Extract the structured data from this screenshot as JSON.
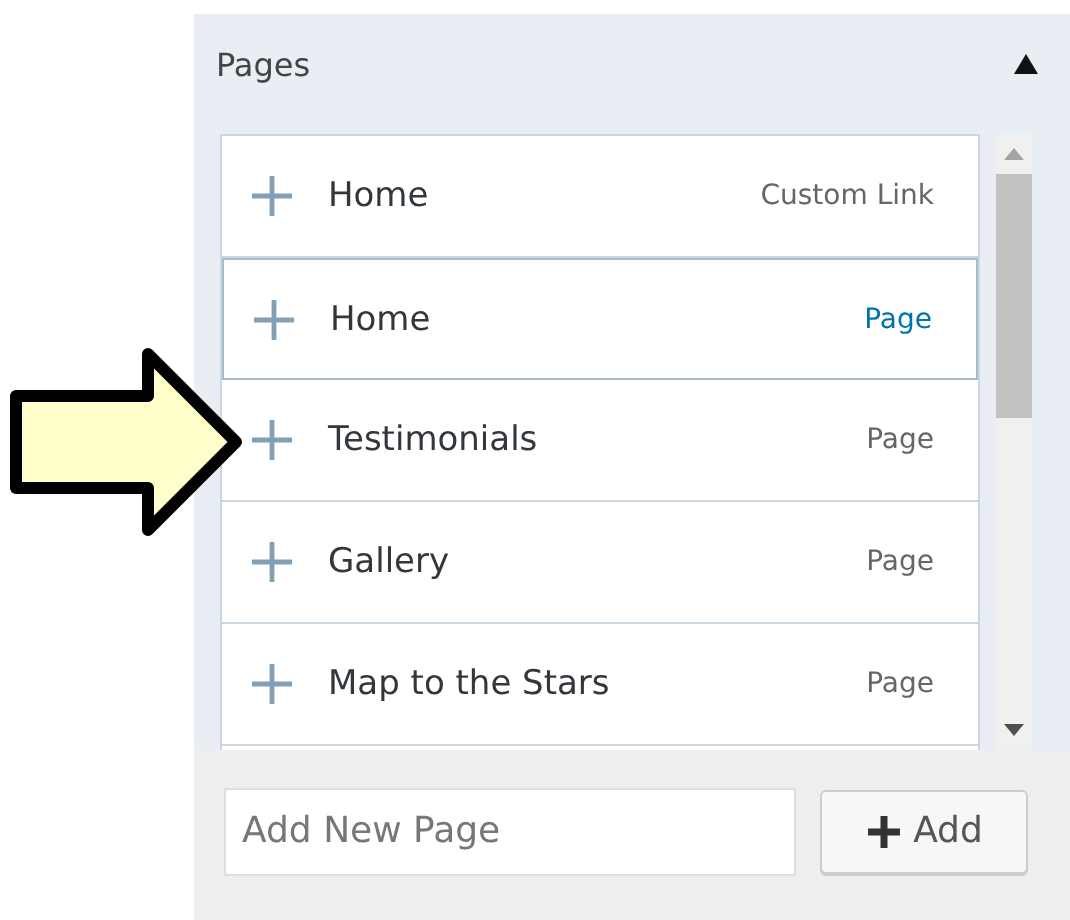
{
  "panel": {
    "title": "Pages",
    "expanded": true
  },
  "items": [
    {
      "label": "Home",
      "type": "Custom Link",
      "highlighted": false
    },
    {
      "label": "Home",
      "type": "Page",
      "highlighted": true
    },
    {
      "label": "Testimonials",
      "type": "Page",
      "highlighted": false
    },
    {
      "label": "Gallery",
      "type": "Page",
      "highlighted": false
    },
    {
      "label": "Map to the Stars",
      "type": "Page",
      "highlighted": false
    }
  ],
  "add_field": {
    "placeholder": "Add New Page"
  },
  "add_button": {
    "label": "Add"
  }
}
